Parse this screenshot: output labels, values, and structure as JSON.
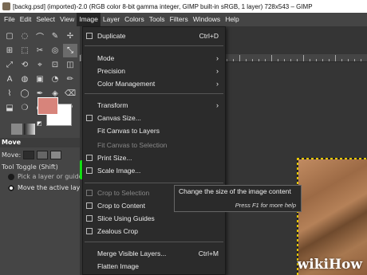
{
  "window": {
    "title": "[backg.psd] (imported)-2.0 (RGB color 8-bit gamma integer, GIMP built-in sRGB, 1 layer) 728x543 – GIMP"
  },
  "menubar": [
    "File",
    "Edit",
    "Select",
    "View",
    "Image",
    "Layer",
    "Colors",
    "Tools",
    "Filters",
    "Windows",
    "Help"
  ],
  "image_menu": {
    "duplicate": {
      "label": "Duplicate",
      "shortcut": "Ctrl+D"
    },
    "mode": "Mode",
    "precision": "Precision",
    "color_management": "Color Management",
    "transform": "Transform",
    "canvas_size": "Canvas Size...",
    "fit_canvas_layers": "Fit Canvas to Layers",
    "fit_canvas_selection": "Fit Canvas to Selection",
    "print_size": "Print Size...",
    "scale_image": "Scale Image...",
    "crop_selection": "Crop to Selection",
    "crop_content": "Crop to Content",
    "slice_guides": "Slice Using Guides",
    "zealous_crop": "Zealous Crop",
    "merge_visible": {
      "label": "Merge Visible Layers...",
      "shortcut": "Ctrl+M"
    },
    "flatten": "Flatten Image",
    "arrow": "›"
  },
  "tooltip": {
    "text": "Change the size of the image content",
    "hint": "Press F1 for more help"
  },
  "tool_options": {
    "tab": "Move",
    "move_label": "Move:",
    "toggle_label": "Tool Toggle  (Shift)",
    "option1": "Pick a layer or guide",
    "option2": "Move the active layer"
  },
  "colors": {
    "foreground": "#d7847b",
    "background": "#ffffff",
    "highlight": "#14e414"
  },
  "tools": [
    "▢",
    "◌",
    "⌒",
    "✎",
    "✢",
    "⊞",
    "⬚",
    "✂",
    "◎",
    "⤡",
    "⤢",
    "⟲",
    "⌖",
    "⊡",
    "◫",
    "A",
    "◍",
    "▣",
    "◔",
    "✏",
    "⌇",
    "◯",
    "✒",
    "◈",
    "⌫",
    "⬓",
    "❍",
    "◐",
    "☀",
    "⚲"
  ],
  "watermark": "wikiHow"
}
